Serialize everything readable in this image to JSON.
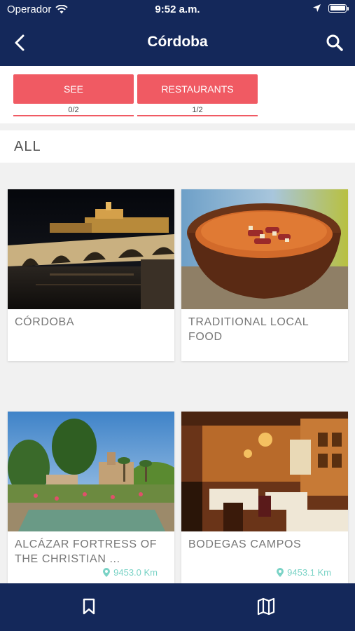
{
  "status_bar": {
    "carrier": "Operador",
    "time": "9:52 a.m.",
    "icons": [
      "wifi-icon",
      "location-arrow-icon",
      "battery-icon"
    ]
  },
  "nav": {
    "title": "Córdoba",
    "back_icon": "chevron-left-icon",
    "search_icon": "search-icon"
  },
  "tabs": [
    {
      "label": "SEE",
      "count": "0/2"
    },
    {
      "label": "RESTAURANTS",
      "count": "1/2"
    }
  ],
  "section": {
    "title": "ALL"
  },
  "cards": [
    {
      "title": "CÓRDOBA",
      "distance": ""
    },
    {
      "title": " TRADITIONAL LOCAL FOOD",
      "distance": ""
    },
    {
      "title": "ALCÁZAR FORTRESS OF THE CHRISTIAN ...",
      "distance": "9453.0 Km"
    },
    {
      "title": "BODEGAS CAMPOS",
      "distance": "9453.1 Km"
    }
  ],
  "tab_bar": {
    "items": [
      "bookmark-icon",
      "map-icon"
    ]
  },
  "colors": {
    "primary": "#14285a",
    "accent": "#f05a63",
    "distance": "#7ad3c6"
  }
}
